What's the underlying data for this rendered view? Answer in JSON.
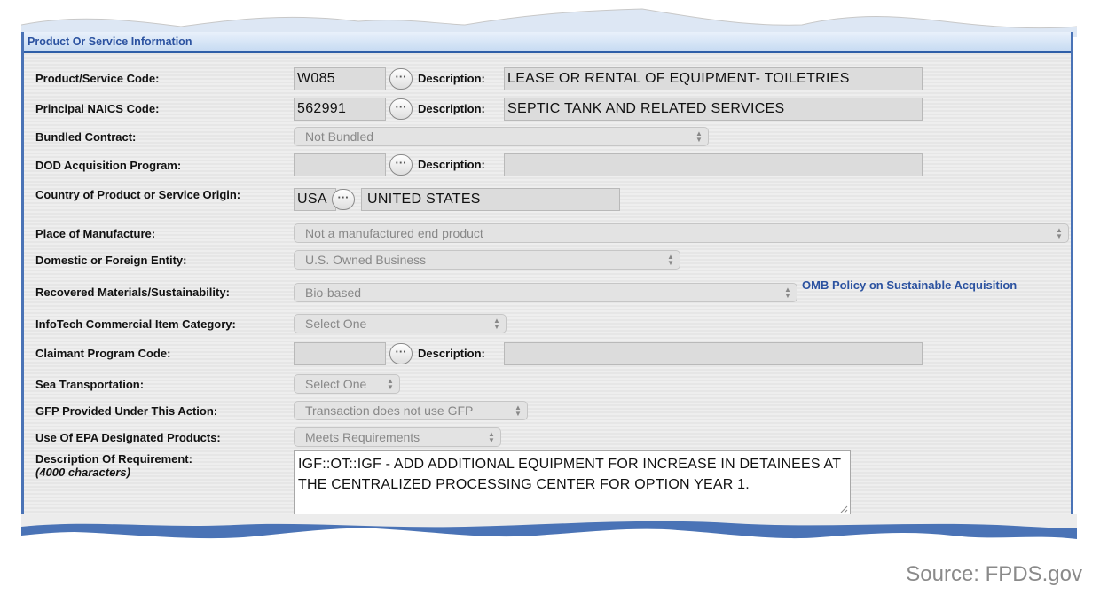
{
  "section": {
    "title": "Product Or Service Information"
  },
  "product_service_code": {
    "label": "Product/Service Code:",
    "value": "W085",
    "desc_label": "Description:",
    "description": "LEASE OR RENTAL OF EQUIPMENT- TOILETRIES"
  },
  "naics": {
    "label": "Principal NAICS Code:",
    "value": "562991",
    "desc_label": "Description:",
    "description": "SEPTIC TANK AND RELATED SERVICES"
  },
  "bundled": {
    "label": "Bundled Contract:",
    "selected": "Not Bundled"
  },
  "dod_program": {
    "label": "DOD Acquisition Program:",
    "value": "",
    "desc_label": "Description:",
    "description": ""
  },
  "country": {
    "label": "Country of Product or Service Origin:",
    "code": "USA",
    "name": "UNITED STATES"
  },
  "place_of_manufacture": {
    "label": "Place of Manufacture:",
    "selected": "Not a manufactured end product"
  },
  "domestic_foreign": {
    "label": "Domestic or Foreign Entity:",
    "selected": "U.S. Owned Business"
  },
  "recovered_materials": {
    "label": "Recovered Materials/Sustainability:",
    "selected": "Bio-based",
    "link": "OMB Policy on Sustainable Acquisition"
  },
  "infotech": {
    "label": "InfoTech Commercial Item Category:",
    "selected": "Select One"
  },
  "claimant": {
    "label": "Claimant Program Code:",
    "value": "",
    "desc_label": "Description:",
    "description": ""
  },
  "sea_transport": {
    "label": "Sea Transportation:",
    "selected": "Select One"
  },
  "gfp": {
    "label": "GFP Provided Under This Action:",
    "selected": "Transaction does not use GFP"
  },
  "epa": {
    "label": "Use Of EPA Designated Products:",
    "selected": "Meets Requirements"
  },
  "description_req": {
    "label": "Description Of Requirement:",
    "sublabel": "(4000 characters)",
    "value": "IGF::OT::IGF - ADD ADDITIONAL EQUIPMENT FOR INCREASE IN DETAINEES AT THE CENTRALIZED PROCESSING CENTER FOR OPTION YEAR 1."
  },
  "source": "Source: FPDS.gov",
  "colors": {
    "accent": "#2b52a0",
    "border": "#4a73b6",
    "panel": "#ececec"
  },
  "icons": {
    "lookup": "ellipsis-icon",
    "select": "updown-arrows-icon",
    "resize": "resize-grip-icon"
  }
}
